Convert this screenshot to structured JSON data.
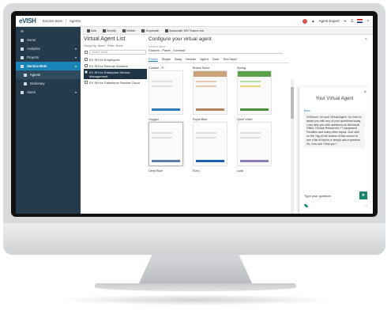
{
  "topbar": {
    "logo": "eVISH",
    "breadcrumbs": [
      "Service Bots",
      "Agents"
    ],
    "user": "Agent Expert"
  },
  "sidebar": {
    "items": [
      {
        "label": "Home"
      },
      {
        "label": "Analytics"
      },
      {
        "label": "Projects"
      },
      {
        "label": "Service Bots"
      },
      {
        "label": "Agents"
      },
      {
        "label": "Dictionary"
      },
      {
        "label": "Users"
      }
    ]
  },
  "toolbar": {
    "add": "Add",
    "modify": "Modify",
    "delete": "Delete",
    "duplicate": "Duplicate",
    "associate": "Associate MS Teams bot"
  },
  "list": {
    "title": "Virtual Agent List",
    "group": "Group by: None",
    "filter": "Filter: None",
    "search_placeholder": "Search items",
    "items": [
      "EV SH for Employees",
      "EV SH for Remote Workers",
      "EV SH for Enterprise Service Management",
      "EV SH for Salesforce Service Cloud"
    ]
  },
  "config": {
    "title": "Configure your virtual agent",
    "field_label": "Name of theme",
    "field_value": "Custom - Panel - Contrast",
    "tabs": [
      "Preset",
      "Shape",
      "Body",
      "Header",
      "Agent",
      "User",
      "Text Input"
    ],
    "themes": [
      "Custom - P...",
      "Brown Sand",
      "Spring",
      "Oxygen",
      "Royal Blue",
      "Quiet Violet",
      "Deep Blue",
      "Echo",
      "Lush"
    ]
  },
  "agent": {
    "title": "Your Virtual Agent",
    "bot_name": "Boss",
    "message": "Hi Boson, I'm your Virtual Agent. I'm here to assist you with any of your questions today. I can help you with questions on Microsoft Office, Human Resources, IT equipment, Facilities and many other topics. Just click on the Tag at the bottom of this screen to see a list of topics or simply ask a question. So, how can I help you?",
    "input_placeholder": "Type your question"
  },
  "colors": {
    "sidebar": "#253a4a",
    "accent": "#1a84b8",
    "send": "#17856e"
  }
}
